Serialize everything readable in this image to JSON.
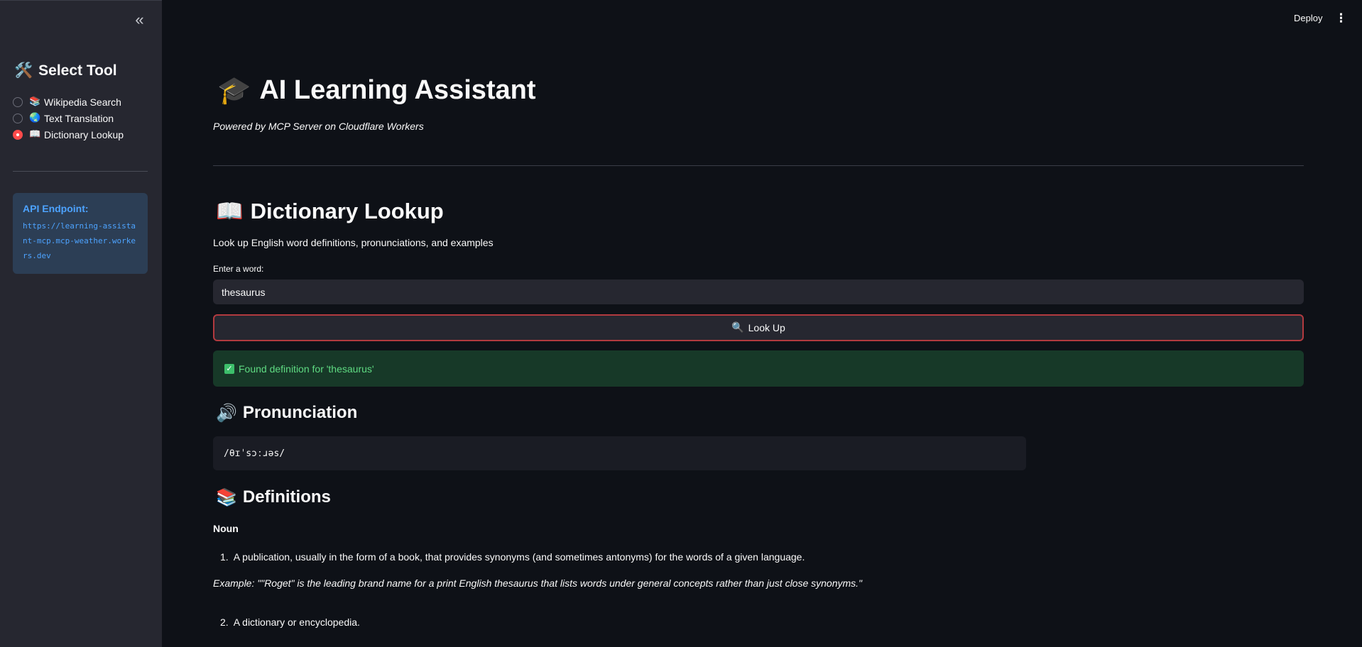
{
  "sidebar": {
    "collapse_label": "«",
    "heading_icon": "🛠️",
    "heading": "Select Tool",
    "tools": [
      {
        "icon": "📚",
        "label": "Wikipedia Search",
        "selected": false
      },
      {
        "icon": "🌏",
        "label": "Text Translation",
        "selected": false
      },
      {
        "icon": "📖",
        "label": "Dictionary Lookup",
        "selected": true
      }
    ],
    "api": {
      "title": "API Endpoint:",
      "url": "https://learning-assistant-mcp.mcp-weather.workers.dev"
    }
  },
  "header": {
    "deploy_label": "Deploy",
    "menu_icon": "⋮"
  },
  "main": {
    "title_icon": "🎓",
    "title": "AI Learning Assistant",
    "subtitle": "Powered by MCP Server on Cloudflare Workers",
    "section_icon": "📖",
    "section_title": "Dictionary Lookup",
    "section_desc": "Look up English word definitions, pronunciations, and examples",
    "input_label": "Enter a word:",
    "input_value": "thesaurus",
    "button_icon": "🔍",
    "button_label": "Look Up",
    "success_icon": "✓",
    "success_text": "Found definition for 'thesaurus'",
    "pronunciation_icon": "🔊",
    "pronunciation_heading": "Pronunciation",
    "pronunciation": "/θɪˈsɔːɹəs/",
    "definitions_icon": "📚",
    "definitions_heading": "Definitions",
    "part_of_speech": "Noun",
    "definitions": [
      {
        "num": "1.",
        "text": "A publication, usually in the form of a book, that provides synonyms (and sometimes antonyms) for the words of a given language."
      },
      {
        "num": "2.",
        "text": "A dictionary or encyclopedia."
      }
    ],
    "example": "Example: \"\"Roget\" is the leading brand name for a print English thesaurus that lists words under general concepts rather than just close synonyms.\""
  },
  "colors": {
    "background": "#0e1117",
    "sidebar": "#262730",
    "accent": "#ff4b4b",
    "link": "#4da3ff",
    "success_bg": "#173928",
    "success_text": "#5fdb82"
  }
}
